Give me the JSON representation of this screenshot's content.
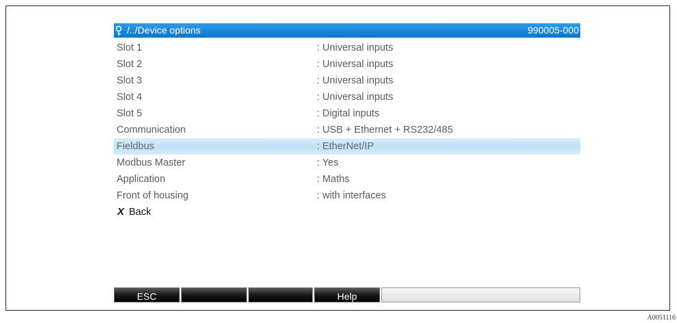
{
  "header": {
    "path": "/../Device options",
    "code": "990005-000",
    "icon": "key-icon"
  },
  "rows": [
    {
      "label": "Slot 1",
      "value": ": Universal inputs"
    },
    {
      "label": "Slot 2",
      "value": ": Universal inputs"
    },
    {
      "label": "Slot 3",
      "value": ": Universal inputs"
    },
    {
      "label": "Slot 4",
      "value": ": Universal inputs"
    },
    {
      "label": "Slot 5",
      "value": ": Digital inputs"
    },
    {
      "label": "Communication",
      "value": ": USB + Ethernet + RS232/485"
    },
    {
      "label": "Fieldbus",
      "value": ": EtherNet/IP",
      "selected": true
    },
    {
      "label": "Modbus Master",
      "value": ": Yes"
    },
    {
      "label": "Application",
      "value": ": Maths"
    },
    {
      "label": "Front of housing",
      "value": ": with interfaces"
    }
  ],
  "back": {
    "icon": "x-icon",
    "label": "Back"
  },
  "softkeys": [
    "ESC",
    "",
    "",
    "Help"
  ],
  "colors": {
    "title_bar": "#1a86dc",
    "selected_row": "#c8e6f7",
    "row_text": "#5a5a5a"
  },
  "ref_code": "A0051116"
}
